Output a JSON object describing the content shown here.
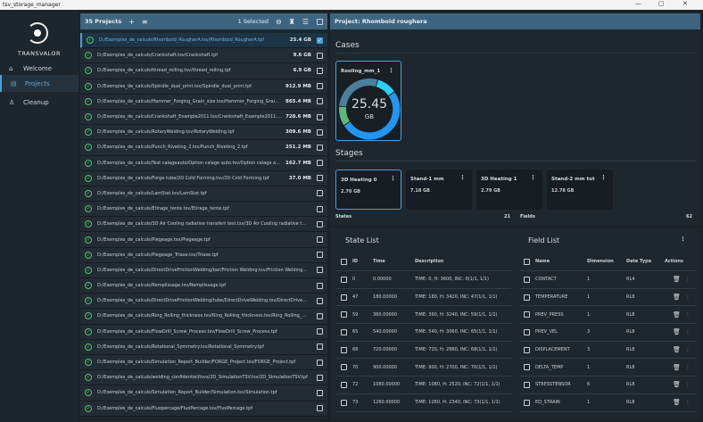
{
  "window": {
    "title": "tsv_storage_manager",
    "controls": [
      "—",
      "▢",
      "✕"
    ]
  },
  "sidebar": {
    "brand": "TRANSVALOR",
    "items": [
      {
        "label": "Welcome",
        "icon": "home-icon"
      },
      {
        "label": "Projects",
        "icon": "projects-icon",
        "active": true
      },
      {
        "label": "Cleanup",
        "icon": "cleanup-icon"
      }
    ]
  },
  "projects": {
    "count_label": "35 Projects",
    "selected_label": "1 Selected",
    "items": [
      {
        "path": "D:/Exemples_de_calculs/Rhomboid_RougherA.tsv/Rhomboid_RougherA.tpf",
        "size": "25.4 GB",
        "checked": true
      },
      {
        "path": "D:/Exemples_de_calculs/Crankshaft.tsv/Crankshaft.tpf",
        "size": "9.6 GB"
      },
      {
        "path": "D:/Exemples_de_calculs/thread_rolling.tsv/thread_rolling.tpf",
        "size": "6.9 GB"
      },
      {
        "path": "D:/Exemples_de_calculs/Spindle_dual_print.tsv/Spindle_dual_print.tpf",
        "size": "912.9 MB"
      },
      {
        "path": "D:/Exemples_de_calculs/Hammer_Forging_Grain_size.tsv/Hammer_Forging_Grain_size.tpf",
        "size": "865.4 MB"
      },
      {
        "path": "D:/Exemples_de_calculs/Crankshaft_Example2011.tsv/Crankshaft_Example2011.tpf",
        "size": "728.6 MB"
      },
      {
        "path": "D:/Exemples_de_calculs/RotaryWelding.tsv/RotaryWelding.tpf",
        "size": "309.6 MB"
      },
      {
        "path": "D:/Exemples_de_calculs/Punch_Riveting_2.tsv/Punch_Riveting_2.tpf",
        "size": "251.2 MB"
      },
      {
        "path": "D:/Exemples_de_calculs/Test calageauto/Option calage auto.tsv/Option calage auto.tpf",
        "size": "162.7 MB"
      },
      {
        "path": "D:/Exemples_de_calculs/Forge tube/2D Cold Forming.tsv/2D Cold Forming.tpf",
        "size": "37.0 MB"
      },
      {
        "path": "D:/Exemples_de_calculs/LamStat.tsv/LamStat.tpf",
        "size": ""
      },
      {
        "path": "D:/Exemples_de_calculs/Etirage_tente.tsv/Etirage_tente.tpf",
        "size": ""
      },
      {
        "path": "D:/Exemples_de_calculs/3D Air Cooling radiative transfert test.tsv/3D Air Cooling radiative transfert test.tpf",
        "size": ""
      },
      {
        "path": "D:/Exemples_de_calculs/Piegeage.tsv/Piegeage.tpf",
        "size": ""
      },
      {
        "path": "D:/Exemples_de_calculs/Piegeage_Triaxe.tsv/Triaxe.tpf",
        "size": ""
      },
      {
        "path": "D:/Exemples_de_calculs/DirectDriveFrictionWelding/bar/Friction Welding.tsv/Friction Welding.tpf",
        "size": ""
      },
      {
        "path": "D:/Exemples_de_calculs/Remplissage.tsv/Remplissage.tpf",
        "size": ""
      },
      {
        "path": "D:/Exemples_de_calculs/DirectDriveFrictionWelding/tube/DirectDriveWelding.tsv/DirectDriveWelding.tpf",
        "size": ""
      },
      {
        "path": "D:/Exemples_de_calculs/Ring_Rolling_thickness.tsv/Ring_Rolling_thickness.tsv/Ring_Rolling_thickness.tpf",
        "size": ""
      },
      {
        "path": "D:/Exemples_de_calculs/FlowDrill_Screw_Process.tsv/FlowDrill_Screw_Process.tpf",
        "size": ""
      },
      {
        "path": "D:/Exemples_de_calculs/Rotational_Symmetry.tsv/Rotational_Symmetry.tpf",
        "size": ""
      },
      {
        "path": "D:/Exemples_de_calculs/Simulation_Report_Builder/FORGE_Project.tsv/FORGE_Project.tpf",
        "size": ""
      },
      {
        "path": "D:/Exemples_de_calculs/welding_confidentiel/tsvs/2D_SimulationTSV.tsv/2D_SimulationTSV.tpf",
        "size": ""
      },
      {
        "path": "D:/Exemples_de_calculs/Simulation_Report_Builder/Simulation.tsv/Simulation.tpf",
        "size": ""
      },
      {
        "path": "D:/Exemples_de_calculs/Fluopercage/FluoPercage.tsv/FluoPercage.tpf",
        "size": ""
      }
    ]
  },
  "project": {
    "title": "Project: Rhomboid roughera",
    "cases_label": "Cases",
    "case": {
      "name": "Rooling_mm_1",
      "total": "25.45",
      "unit": "GB",
      "segments": [
        {
          "value": 2.7,
          "color": "#5fb87a"
        },
        {
          "value": 7.18,
          "color": "#4a7f9e"
        },
        {
          "value": 2.79,
          "color": "#2ad0f2"
        },
        {
          "value": 12.78,
          "color": "#2196f3"
        }
      ]
    },
    "stages_label": "Stages",
    "stages": [
      {
        "name": "3D Heating 0",
        "size": "2.70 GB",
        "selected": true
      },
      {
        "name": "Stand-1 mm",
        "size": "7.18 GB"
      },
      {
        "name": "3D Heating 1",
        "size": "2.79 GB"
      },
      {
        "name": "Stand-2 mm tot",
        "size": "12.78 GB"
      }
    ],
    "states_label": "States",
    "states_count": "21",
    "fields_label": "Fields",
    "fields_count": "62"
  },
  "state_list": {
    "title": "State List",
    "headers": [
      "ID",
      "Time",
      "Description"
    ],
    "rows": [
      [
        "0",
        "0.00000",
        "TIME: 0, H: 3600, INC: 0(1/1, 1/1)"
      ],
      [
        "47",
        "180.00000",
        "TIME: 180, H: 3420, INC: 47(1/1, 1/1)"
      ],
      [
        "59",
        "360.00000",
        "TIME: 360, H: 3240, INC: 59(1/1, 1/1)"
      ],
      [
        "65",
        "540.00000",
        "TIME: 540, H: 3060, INC: 65(1/1, 1/1)"
      ],
      [
        "68",
        "720.00000",
        "TIME: 720, H: 2880, INC: 68(1/1, 1/1)"
      ],
      [
        "70",
        "900.00000",
        "TIME: 900, H: 2700, INC: 70(1/1, 1/1)"
      ],
      [
        "72",
        "1080.00000",
        "TIME: 1080, H: 2520, INC: 72(1/1, 1/1)"
      ],
      [
        "73",
        "1260.00000",
        "TIME: 1260, H: 2340, INC: 73(1/1, 1/1)"
      ]
    ]
  },
  "field_list": {
    "title": "Field List",
    "headers": [
      "Name",
      "Dimension",
      "Date Type",
      "Actions"
    ],
    "rows": [
      [
        "CONTACT",
        "1",
        "RL4"
      ],
      [
        "TEMPERATURE",
        "1",
        "RL8"
      ],
      [
        "PREV_PRESS",
        "1",
        "RL8"
      ],
      [
        "PREV_VEL",
        "3",
        "RL8"
      ],
      [
        "DISPLACEMENT",
        "3",
        "RL8"
      ],
      [
        "DELTA_TEMP",
        "1",
        "RL8"
      ],
      [
        "STRESSTENSOR",
        "6",
        "RL8"
      ],
      [
        "EQ_STRAIN",
        "1",
        "RL8"
      ]
    ]
  }
}
